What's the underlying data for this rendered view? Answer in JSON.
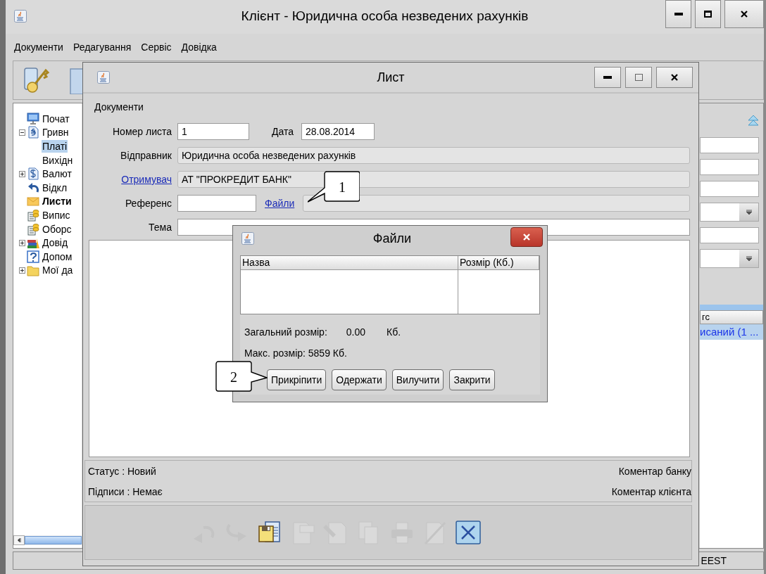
{
  "window": {
    "title": "Клієнт - Юридична особа незведених рахунків"
  },
  "menu": [
    "Документи",
    "Редагування",
    "Сервіс",
    "Довідка"
  ],
  "nav_tree": [
    {
      "label": "Почат",
      "kind": "monitor",
      "bold": false,
      "selected": false
    },
    {
      "label": "Гривн",
      "kind": "hryvnia",
      "bold": false,
      "selected": false,
      "expanded": true,
      "children": [
        {
          "label": "Платі",
          "kind": "none",
          "bold": false,
          "selected": true
        },
        {
          "label": "Вихідн",
          "kind": "none",
          "bold": false,
          "selected": false
        }
      ]
    },
    {
      "label": "Валют",
      "kind": "dollar",
      "bold": false,
      "selected": false,
      "expanded": false
    },
    {
      "label": "Відкл",
      "kind": "return",
      "bold": false,
      "selected": false
    },
    {
      "label": "Листи",
      "kind": "envelope",
      "bold": true,
      "selected": false
    },
    {
      "label": "Випис",
      "kind": "coins",
      "bold": false,
      "selected": false
    },
    {
      "label": "Оборс",
      "kind": "coins",
      "bold": false,
      "selected": false
    },
    {
      "label": "Довід",
      "kind": "books",
      "bold": false,
      "selected": false,
      "expanded": false
    },
    {
      "label": "Допом",
      "kind": "help",
      "bold": false,
      "selected": false
    },
    {
      "label": "Мої да",
      "kind": "folder",
      "bold": false,
      "selected": false,
      "expanded": false
    }
  ],
  "right_panel": {
    "table": {
      "columns": [
        "гс"
      ],
      "rows": [
        {
          "cells": [
            "исаний (1 ..."
          ],
          "selected": true
        }
      ]
    }
  },
  "status_bar": {
    "segments": [
      "EEST"
    ]
  },
  "letter": {
    "title": "Лист",
    "section": "Документи",
    "number": {
      "label": "Номер листа",
      "value": "1"
    },
    "date": {
      "label": "Дата",
      "value": "28.08.2014"
    },
    "sender": {
      "label": "Відправник",
      "value": "Юридична особа незведених рахунків"
    },
    "recipient": {
      "label": "Отримувач",
      "value": "АТ \"ПРОКРЕДИТ БАНК\""
    },
    "reference": {
      "label": "Референс"
    },
    "files_link": "Файли",
    "subject": {
      "label": "Тема"
    },
    "status_label": "Статус :",
    "status": "Новий",
    "bank_comment": "Коментар банку",
    "signatures_label": "Підписи :",
    "signatures": "Немає",
    "client_comment": "Коментар клієнта",
    "toolbar": [
      {
        "kind": "undo",
        "disabled": true
      },
      {
        "kind": "redo",
        "disabled": true
      },
      {
        "kind": "save",
        "disabled": false
      },
      {
        "kind": "rename",
        "disabled": true
      },
      {
        "kind": "sign",
        "disabled": true
      },
      {
        "kind": "copy",
        "disabled": true
      },
      {
        "kind": "print",
        "disabled": true
      },
      {
        "kind": "delete",
        "disabled": true
      },
      {
        "kind": "close",
        "disabled": false
      }
    ]
  },
  "files_dialog": {
    "title": "Файли",
    "columns": [
      "Назва",
      "Розмір (Кб.)"
    ],
    "total_label": "Загальний розмір:",
    "total_value": "0.00",
    "total_unit": "Кб.",
    "max_size": "Макс. розмір: 5859 Кб.",
    "buttons": [
      "Прикріпити",
      "Одержати",
      "Вилучити",
      "Закрити"
    ]
  },
  "callouts": [
    {
      "label": "1"
    },
    {
      "label": "2"
    }
  ]
}
